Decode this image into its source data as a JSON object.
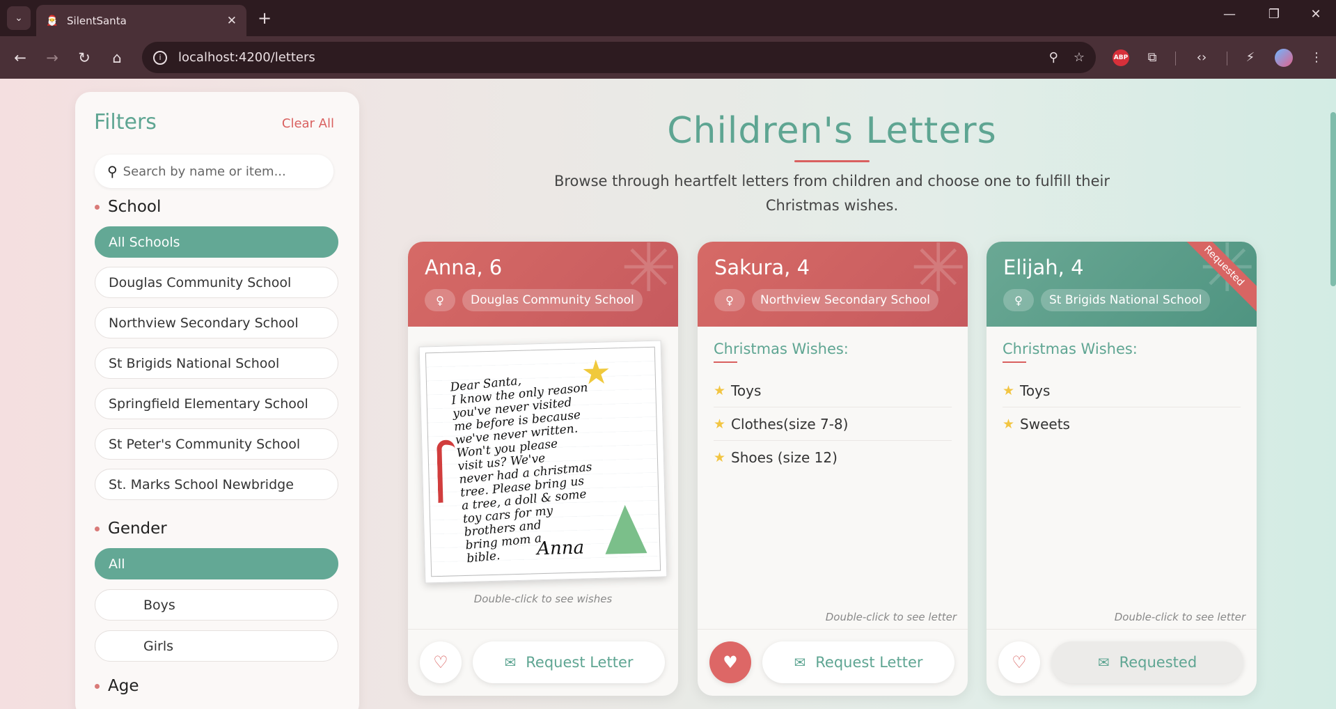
{
  "browser": {
    "tab_title": "SilentSanta",
    "url": "localhost:4200/letters"
  },
  "filters": {
    "title": "Filters",
    "clear_label": "Clear All",
    "search_placeholder": "Search by name or item...",
    "school": {
      "title": "School",
      "options": [
        "All Schools",
        "Douglas Community School",
        "Northview Secondary School",
        "St Brigids National School",
        "Springfield Elementary School",
        "St Peter's Community School",
        "St. Marks School Newbridge"
      ]
    },
    "gender": {
      "title": "Gender",
      "options": [
        "All",
        "Boys",
        "Girls"
      ]
    },
    "age": {
      "title": "Age"
    }
  },
  "heading": {
    "title": "Children's Letters",
    "subtitle": "Browse through heartfelt letters from children and choose one to fulfill their Christmas wishes."
  },
  "cards": [
    {
      "name": "Anna, 6",
      "gender_icon": "♀",
      "school": "Douglas Community School",
      "letter_text": "Dear Santa,\nI know the only reason\nyou've never visited\nme before is because\nwe've never written.\nWon't you please\nvisit us? We've\nnever had a christmas\ntree. Please bring us\na tree, a doll & some\ntoy cars for my\nbrothers and\nbring mom a\nbible.",
      "letter_signature": "Anna",
      "hint": "Double-click to see wishes",
      "request_label": "Request Letter"
    },
    {
      "name": "Sakura, 4",
      "gender_icon": "♀",
      "school": "Northview Secondary School",
      "wishes_title": "Christmas Wishes:",
      "wishes": [
        "Toys",
        "Clothes(size 7-8)",
        "Shoes (size 12)"
      ],
      "hint": "Double-click to see letter",
      "request_label": "Request Letter"
    },
    {
      "name": "Elijah, 4",
      "gender_icon": "♀",
      "school": "St Brigids National School",
      "ribbon": "Requested",
      "wishes_title": "Christmas Wishes:",
      "wishes": [
        "Toys",
        "Sweets"
      ],
      "hint": "Double-click to see letter",
      "request_label": "Requested"
    }
  ],
  "colors": {
    "accent_green": "#5ea592",
    "accent_red": "#d9605f"
  }
}
